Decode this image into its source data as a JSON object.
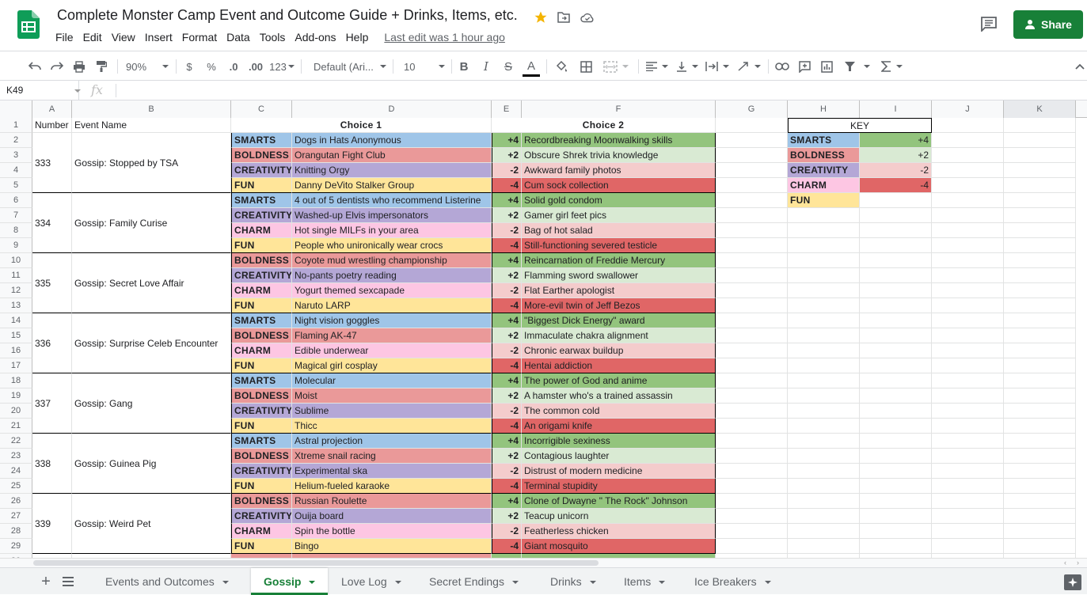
{
  "doc": {
    "title": "Complete Monster Camp Event and Outcome Guide + Drinks, Items, etc.",
    "last_edit": "Last edit was 1 hour ago",
    "share_label": "Share"
  },
  "menu": [
    "File",
    "Edit",
    "View",
    "Insert",
    "Format",
    "Data",
    "Tools",
    "Add-ons",
    "Help"
  ],
  "toolbar": {
    "zoom": "90%",
    "currency": "$",
    "percent": "%",
    "dec_decrease": ".0",
    "dec_increase": ".00",
    "more_formats": "123",
    "font": "Default (Ari...",
    "font_size": "10",
    "bold": "B",
    "italic": "I",
    "strike": "S",
    "text_color": "A"
  },
  "formula_bar": {
    "cell_ref": "K49",
    "fx": "fx",
    "value": ""
  },
  "columns": [
    "A",
    "B",
    "C",
    "D",
    "E",
    "F",
    "G",
    "H",
    "I",
    "J",
    "K"
  ],
  "headers": {
    "number": "Number",
    "event_name": "Event Name",
    "choice1": "Choice 1",
    "choice2": "Choice 2",
    "key": "KEY"
  },
  "colors": {
    "SMARTS": "#9fc5e8",
    "BOLDNESS": "#ea9999",
    "CREATIVITY": "#b4a7d6",
    "CHARM": "#fdc6e3",
    "FUN": "#ffe599",
    "+4": "#93c47d",
    "+2": "#d9ead3",
    "-2": "#f4cccc",
    "-4": "#e06666",
    "accent": "#188038"
  },
  "events": [
    {
      "number": "333",
      "name": "Gossip: Stopped by TSA",
      "rows": [
        {
          "stat": "SMARTS",
          "choice1": "Dogs in Hats Anonymous",
          "mod": "+4",
          "choice2": "Recordbreaking Moonwalking skills"
        },
        {
          "stat": "BOLDNESS",
          "choice1": "Orangutan Fight Club",
          "mod": "+2",
          "choice2": "Obscure Shrek trivia knowledge"
        },
        {
          "stat": "CREATIVITY",
          "choice1": "Knitting Orgy",
          "mod": "-2",
          "choice2": "Awkward family photos"
        },
        {
          "stat": "FUN",
          "choice1": "Danny DeVito Stalker Group",
          "mod": "-4",
          "choice2": "Cum sock collection"
        }
      ]
    },
    {
      "number": "334",
      "name": "Gossip: Family Curise",
      "rows": [
        {
          "stat": "SMARTS",
          "choice1": "4 out of 5 dentists who recommend Listerine",
          "mod": "+4",
          "choice2": "Solid gold condom"
        },
        {
          "stat": "CREATIVITY",
          "choice1": "Washed-up Elvis impersonators",
          "mod": "+2",
          "choice2": "Gamer girl feet pics"
        },
        {
          "stat": "CHARM",
          "choice1": "Hot single MILFs in your area",
          "mod": "-2",
          "choice2": "Bag of hot salad"
        },
        {
          "stat": "FUN",
          "choice1": "People who unironically wear crocs",
          "mod": "-4",
          "choice2": "Still-functioning severed testicle"
        }
      ]
    },
    {
      "number": "335",
      "name": "Gossip: Secret Love Affair",
      "rows": [
        {
          "stat": "BOLDNESS",
          "choice1": "Coyote mud wrestling championship",
          "mod": "+4",
          "choice2": "Reincarnation of Freddie Mercury"
        },
        {
          "stat": "CREATIVITY",
          "choice1": "No-pants poetry reading",
          "mod": "+2",
          "choice2": "Flamming sword swallower"
        },
        {
          "stat": "CHARM",
          "choice1": "Yogurt themed sexcapade",
          "mod": "-2",
          "choice2": "Flat Earther apologist"
        },
        {
          "stat": "FUN",
          "choice1": "Naruto LARP",
          "mod": "-4",
          "choice2": "More-evil twin of Jeff Bezos"
        }
      ]
    },
    {
      "number": "336",
      "name": "Gossip: Surprise Celeb Encounter",
      "rows": [
        {
          "stat": "SMARTS",
          "choice1": "Night vision goggles",
          "mod": "+4",
          "choice2": "\"Biggest Dick Energy\" award"
        },
        {
          "stat": "BOLDNESS",
          "choice1": "Flaming AK-47",
          "mod": "+2",
          "choice2": "Immaculate chakra alignment"
        },
        {
          "stat": "CHARM",
          "choice1": "Edible underwear",
          "mod": "-2",
          "choice2": "Chronic earwax buildup"
        },
        {
          "stat": "FUN",
          "choice1": "Magical girl cosplay",
          "mod": "-4",
          "choice2": "Hentai addiction"
        }
      ]
    },
    {
      "number": "337",
      "name": "Gossip: Gang",
      "rows": [
        {
          "stat": "SMARTS",
          "choice1": "Molecular",
          "mod": "+4",
          "choice2": "The power of God and anime"
        },
        {
          "stat": "BOLDNESS",
          "choice1": "Moist",
          "mod": "+2",
          "choice2": "A hamster who's a trained assassin"
        },
        {
          "stat": "CREATIVITY",
          "choice1": "Sublime",
          "mod": "-2",
          "choice2": "The common cold"
        },
        {
          "stat": "FUN",
          "choice1": "Thicc",
          "mod": "-4",
          "choice2": "An origami knife"
        }
      ]
    },
    {
      "number": "338",
      "name": "Gossip: Guinea Pig",
      "rows": [
        {
          "stat": "SMARTS",
          "choice1": "Astral projection",
          "mod": "+4",
          "choice2": "Incorrigible sexiness"
        },
        {
          "stat": "BOLDNESS",
          "choice1": "Xtreme snail racing",
          "mod": "+2",
          "choice2": "Contagious laughter"
        },
        {
          "stat": "CREATIVITY",
          "choice1": "Experimental ska",
          "mod": "-2",
          "choice2": "Distrust of modern medicine"
        },
        {
          "stat": "FUN",
          "choice1": "Helium-fueled karaoke",
          "mod": "-4",
          "choice2": "Terminal stupidity"
        }
      ]
    },
    {
      "number": "339",
      "name": "Gossip: Weird Pet",
      "rows": [
        {
          "stat": "BOLDNESS",
          "choice1": "Russian Roulette",
          "mod": "+4",
          "choice2": "Clone of Dwayne \" The Rock\" Johnson"
        },
        {
          "stat": "CREATIVITY",
          "choice1": "Ouija board",
          "mod": "+2",
          "choice2": "Teacup unicorn"
        },
        {
          "stat": "CHARM",
          "choice1": "Spin the bottle",
          "mod": "-2",
          "choice2": "Featherless chicken"
        },
        {
          "stat": "FUN",
          "choice1": "Bingo",
          "mod": "-4",
          "choice2": "Giant mosquito"
        }
      ]
    }
  ],
  "key": [
    {
      "stat": "SMARTS",
      "mod": "+4"
    },
    {
      "stat": "BOLDNESS",
      "mod": "+2"
    },
    {
      "stat": "CREATIVITY",
      "mod": "-2"
    },
    {
      "stat": "CHARM",
      "mod": "-4"
    },
    {
      "stat": "FUN",
      "mod": ""
    }
  ],
  "tabs": [
    {
      "label": "Events and Outcomes",
      "active": false
    },
    {
      "label": "Gossip",
      "active": true
    },
    {
      "label": "Love Log",
      "active": false
    },
    {
      "label": "Secret Endings",
      "active": false
    },
    {
      "label": "Drinks",
      "active": false
    },
    {
      "label": "Items",
      "active": false
    },
    {
      "label": "Ice Breakers",
      "active": false
    }
  ]
}
